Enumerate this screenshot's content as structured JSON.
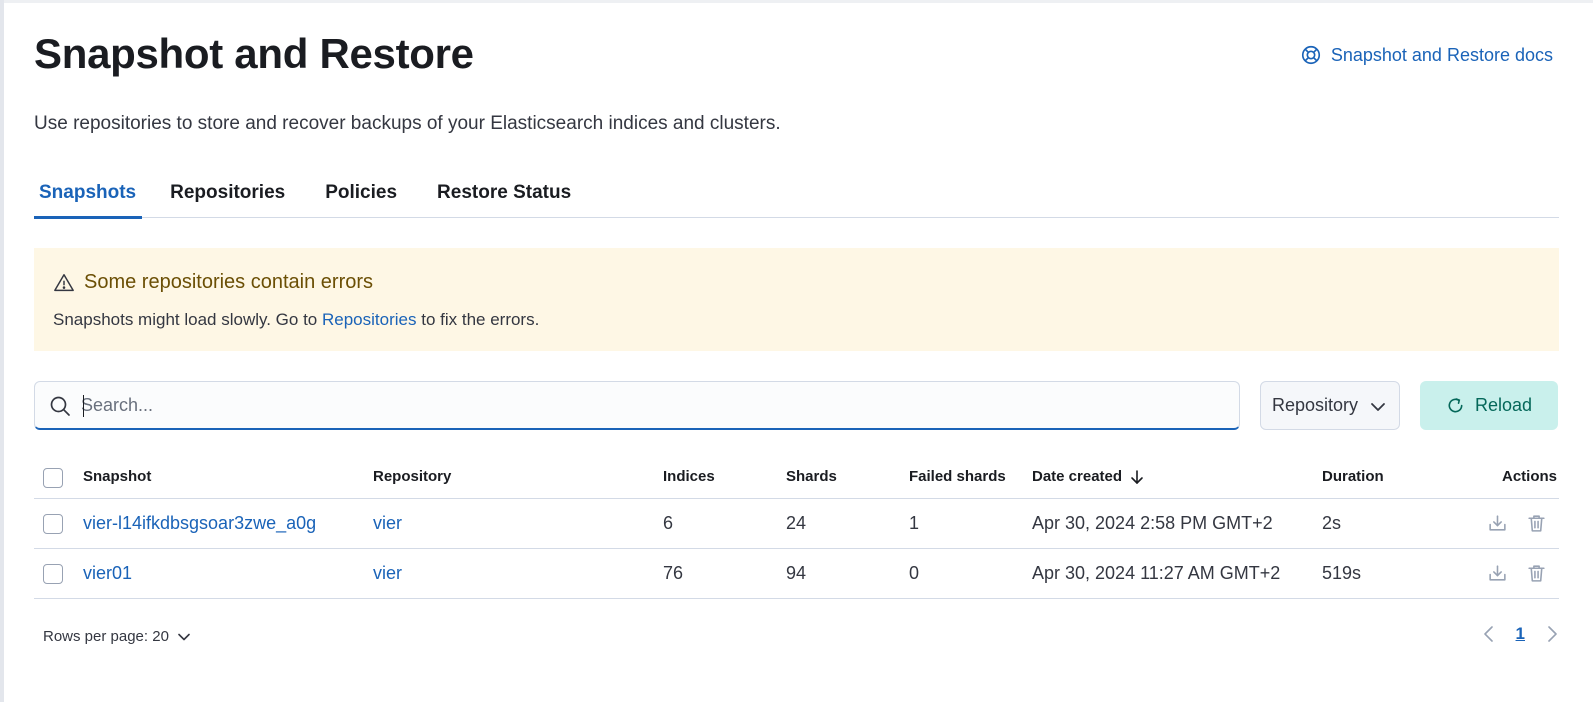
{
  "header": {
    "title": "Snapshot and Restore",
    "docs_link": "Snapshot and Restore docs",
    "description": "Use repositories to store and recover backups of your Elasticsearch indices and clusters."
  },
  "tabs": [
    {
      "label": "Snapshots",
      "selected": true
    },
    {
      "label": "Repositories",
      "selected": false
    },
    {
      "label": "Policies",
      "selected": false
    },
    {
      "label": "Restore Status",
      "selected": false
    }
  ],
  "callout": {
    "title": "Some repositories contain errors",
    "body_prefix": "Snapshots might load slowly. Go to ",
    "body_link": "Repositories",
    "body_suffix": " to fix the errors.",
    "color": "#fef7e5"
  },
  "toolbar": {
    "search_placeholder": "Search...",
    "repository_filter": "Repository",
    "reload_label": "Reload"
  },
  "table": {
    "columns": [
      "Snapshot",
      "Repository",
      "Indices",
      "Shards",
      "Failed shards",
      "Date created",
      "Duration",
      "Actions"
    ],
    "sort_column": "Date created",
    "sort_direction": "descending",
    "rows": [
      {
        "snapshot": "vier-l14ifkdbsgsoar3zwe_a0g",
        "repository": "vier",
        "indices": "6",
        "shards": "24",
        "failed_shards": "1",
        "date_created": "Apr 30, 2024 2:58 PM GMT+2",
        "duration": "2s"
      },
      {
        "snapshot": "vier01",
        "repository": "vier",
        "indices": "76",
        "shards": "94",
        "failed_shards": "0",
        "date_created": "Apr 30, 2024 11:27 AM GMT+2",
        "duration": "519s"
      }
    ]
  },
  "pagination": {
    "rows_per_page": "Rows per page: 20",
    "current_page": "1"
  },
  "colors": {
    "primary": "#1a63b8",
    "reload_bg": "#c9f0ec",
    "warning_bg": "#fef7e5"
  }
}
